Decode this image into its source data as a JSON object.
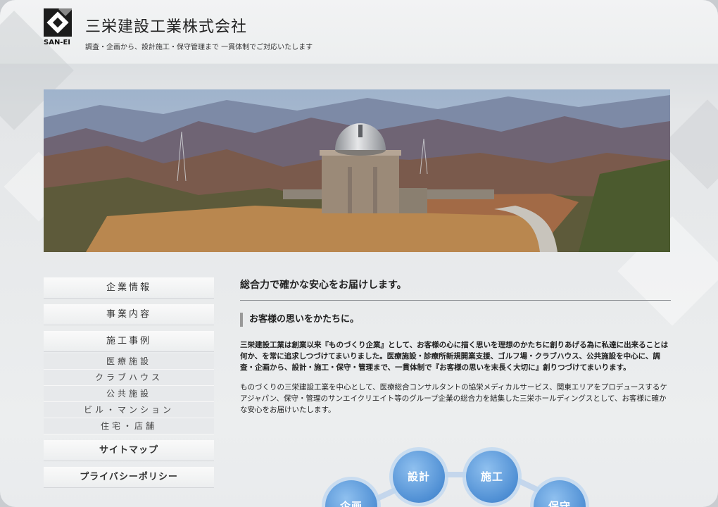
{
  "header": {
    "logo_text": "SAN-EI",
    "company_name": "三栄建設工業株式会社",
    "tagline": "調査・企画から、設計施工・保守管理まで 一貫体制でご対応いたします"
  },
  "sidebar": {
    "items": [
      {
        "label": "企業情報"
      },
      {
        "label": "事業内容"
      },
      {
        "label": "施工事例"
      }
    ],
    "sub_items": [
      {
        "label": "医療施設"
      },
      {
        "label": "クラブハウス"
      },
      {
        "label": "公共施設"
      },
      {
        "label": "ビル・マンション"
      },
      {
        "label": "住宅・店舗"
      }
    ],
    "sitemap_label": "サイトマップ",
    "privacy_label": "プライバシーポリシー"
  },
  "main": {
    "lead": "総合力で確かな安心をお届けします。",
    "subheading": "お客様の思いをかたちに。",
    "paragraph1": "三栄建設工業は創業以来『ものづくり企業』として、お客様の心に描く思いを理想のかたちに創りあげる為に私達に出来ることは何か、を常に追求しつづけてまいりました。医療施設・診療所新規開業支援、ゴルフ場・クラブハウス、公共施設を中心に、調査・企画から、設計・施工・保守・管理まで、一貫体制で『お客様の思いを末長く大切に』創りつづけてまいります。",
    "paragraph2": "ものづくりの三栄建設工業を中心として、医療総合コンサルタントの協栄メディカルサービス、関東エリアをプロデュースするケアジャパン、保守・管理のサンエイクリエイト等のグループ企業の総合力を結集した三栄ホールディングスとして、お客様に確かな安心をお届けいたします。"
  },
  "process": {
    "steps": [
      "企画",
      "設計",
      "施工",
      "保守"
    ]
  },
  "colors": {
    "accent_blue": "#4f8fd4",
    "text": "#222222"
  }
}
